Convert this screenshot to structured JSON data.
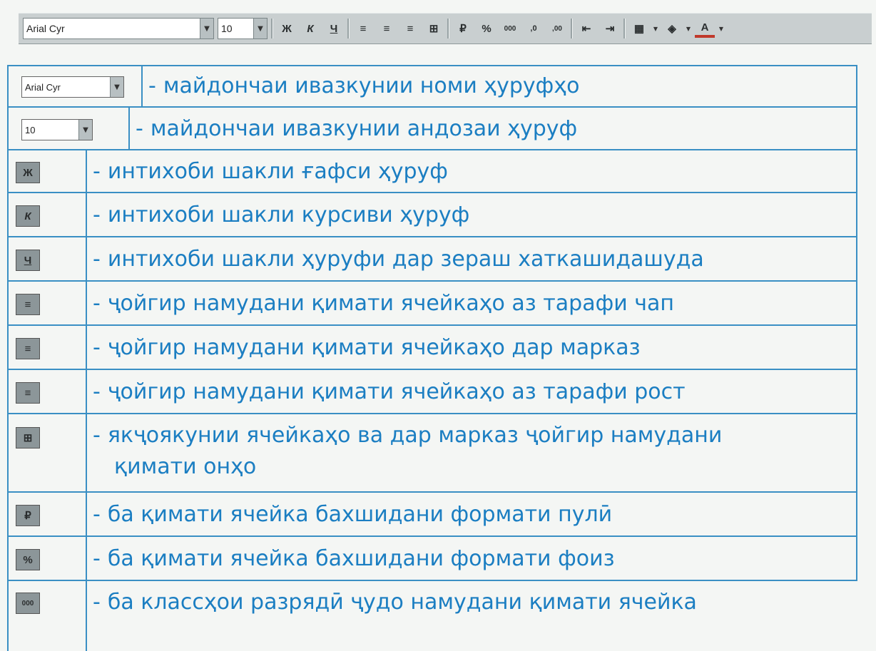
{
  "toolbar": {
    "font_value": "Arial Cyr",
    "size_value": "10",
    "buttons": [
      {
        "icon": "bold-icon",
        "glyph": "Ж"
      },
      {
        "icon": "italic-icon",
        "glyph": "К"
      },
      {
        "icon": "underline-icon",
        "glyph": "Ч"
      },
      {
        "icon": "align-left-icon",
        "glyph": "≡"
      },
      {
        "icon": "align-center-icon",
        "glyph": "≡"
      },
      {
        "icon": "align-right-icon",
        "glyph": "≡"
      },
      {
        "icon": "merge-center-icon",
        "glyph": "⊞"
      },
      {
        "icon": "currency-icon",
        "glyph": "₽"
      },
      {
        "icon": "percent-icon",
        "glyph": "%"
      },
      {
        "icon": "thousands-separator-icon",
        "glyph": "000"
      },
      {
        "icon": "increase-decimal-icon",
        "glyph": ",0"
      },
      {
        "icon": "decrease-decimal-icon",
        "glyph": ",00"
      },
      {
        "icon": "decrease-indent-icon",
        "glyph": "⇤"
      },
      {
        "icon": "increase-indent-icon",
        "glyph": "⇥"
      },
      {
        "icon": "borders-icon",
        "glyph": "▦"
      },
      {
        "icon": "fill-color-icon",
        "glyph": "◈"
      },
      {
        "icon": "font-color-icon",
        "glyph": "A"
      }
    ]
  },
  "legend": {
    "font_combo_text": "Arial Cyr",
    "size_combo_text": "10",
    "rows": [
      {
        "text": "майдончаи ивазкунии номи ҳуруфҳо"
      },
      {
        "text": "майдончаи ивазкунии андозаи ҳуруф"
      },
      {
        "icon": "bold-icon",
        "glyph": "Ж",
        "text": "интихоби шакли ғафси ҳуруф"
      },
      {
        "icon": "italic-icon",
        "glyph": "К",
        "text": "интихоби шакли курсиви ҳуруф"
      },
      {
        "icon": "underline-icon",
        "glyph": "Ч",
        "text": "интихоби шакли ҳуруфи дар зераш хаткашидашуда"
      },
      {
        "icon": "align-left-icon",
        "glyph": "≡",
        "text": "ҷойгир намудани қимати ячейкаҳо аз тарафи чап"
      },
      {
        "icon": "align-center-icon",
        "glyph": "≡",
        "text": "ҷойгир намудани қимати ячейкаҳо дар марказ"
      },
      {
        "icon": "align-right-icon",
        "glyph": "≡",
        "text": "ҷойгир намудани қимати ячейкаҳо аз тарафи рост"
      },
      {
        "icon": "merge-center-icon",
        "glyph": "⊞",
        "text": "якҷоякунии ячейкаҳо ва дар марказ ҷойгир намудани",
        "text2": "қимати онҳо"
      },
      {
        "icon": "currency-icon",
        "glyph": "₽",
        "text": "ба қимати ячейка бахшидани формати пулӣ"
      },
      {
        "icon": "percent-icon",
        "glyph": "%",
        "text": "ба қимати ячейка бахшидани формати фоиз"
      },
      {
        "icon": "thousands-separator-icon",
        "glyph": "000",
        "text": "ба классҳои разрядӣ ҷудо намудани қимати ячейка"
      }
    ]
  }
}
